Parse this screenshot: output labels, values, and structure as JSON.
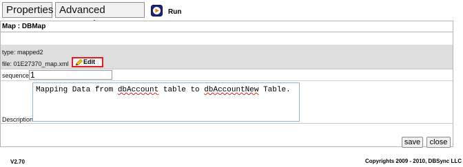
{
  "toolbar": {
    "tabs": [
      "Properties",
      "Advanced Properties"
    ],
    "run_label": "Run"
  },
  "panel": {
    "header": "Map : DBMap",
    "type_text": "type: mapped2",
    "file_text": "file: 01E27370_map.xml",
    "edit_label": "Edit",
    "sequence_label": "sequence:",
    "sequence_value": "1",
    "description_label": "Description:",
    "description_parts": [
      "Mapping Data from ",
      "dbAccount",
      " table to ",
      "dbAccountNew",
      " Table."
    ]
  },
  "actions": {
    "save_label": "save",
    "close_label": "close"
  },
  "footer": {
    "version": "V2.70",
    "copyright": "Copyrights 2009 - 2010, DBSync LLC"
  },
  "colors": {
    "highlight_border": "#e02020",
    "run_icon_bg": "#1a237e",
    "run_icon_arrow": "#ff7a00"
  }
}
